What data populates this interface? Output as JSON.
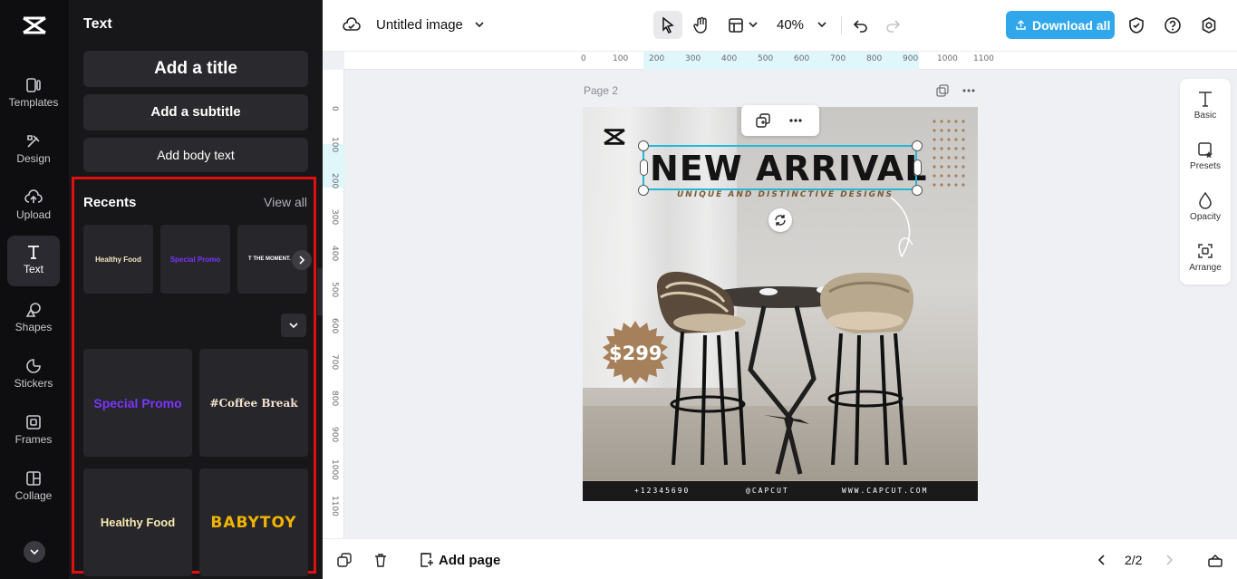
{
  "app": {
    "doc_title": "Untitled image",
    "zoom": "40%",
    "download_label": "Download all"
  },
  "rail": [
    {
      "label": "Templates",
      "icon": "templates-icon"
    },
    {
      "label": "Design",
      "icon": "design-icon"
    },
    {
      "label": "Upload",
      "icon": "upload-icon"
    },
    {
      "label": "Text",
      "icon": "text-icon",
      "active": true
    },
    {
      "label": "Shapes",
      "icon": "shapes-icon"
    },
    {
      "label": "Stickers",
      "icon": "stickers-icon"
    },
    {
      "label": "Frames",
      "icon": "frames-icon"
    },
    {
      "label": "Collage",
      "icon": "collage-icon"
    }
  ],
  "panel": {
    "title": "Text",
    "add_title": "Add a title",
    "add_subtitle": "Add a subtitle",
    "add_body": "Add body text",
    "recents_label": "Recents",
    "view_all": "View all",
    "recents": [
      {
        "text": "Healthy Food",
        "color": "#f3e9c2"
      },
      {
        "text": "Special Promo",
        "color": "#7b35ff"
      },
      {
        "text": "T THE MOMENT.",
        "color": "#ffffff"
      }
    ],
    "styles": [
      {
        "text": "Special Promo",
        "color": "#7b35ff"
      },
      {
        "text": "#Coffee Break",
        "color": "#f5e2cf"
      },
      {
        "text": "Healthy Food",
        "color": "#f7e9b0"
      },
      {
        "text": "BABYTOY",
        "color": "#f0b400"
      }
    ]
  },
  "ruler": {
    "h_ticks": [
      "0",
      "100",
      "200",
      "300",
      "400",
      "500",
      "600",
      "700",
      "800",
      "900",
      "1000",
      "1100"
    ],
    "v_ticks": [
      "0",
      "100",
      "200",
      "300",
      "400",
      "500",
      "600",
      "700",
      "800",
      "900",
      "1000",
      "1100"
    ]
  },
  "canvas": {
    "page_label": "Page 2",
    "headline": "NEW ARRIVAL",
    "subline": "UNIQUE AND DISTINCTIVE DESIGNS",
    "price": "$299",
    "footer": [
      "+12345690",
      "@CAPCUT",
      "WWW.CAPCUT.COM"
    ]
  },
  "props": [
    {
      "label": "Basic",
      "icon": "basic-text-icon"
    },
    {
      "label": "Presets",
      "icon": "presets-icon"
    },
    {
      "label": "Opacity",
      "icon": "opacity-icon"
    },
    {
      "label": "Arrange",
      "icon": "arrange-icon"
    }
  ],
  "bottom": {
    "add_page": "Add page",
    "page_count": "2/2"
  },
  "colors": {
    "accent": "#2fa7ea",
    "selection": "#24b7d6",
    "highlight_box": "#e01010",
    "price_badge": "#a5805a"
  }
}
